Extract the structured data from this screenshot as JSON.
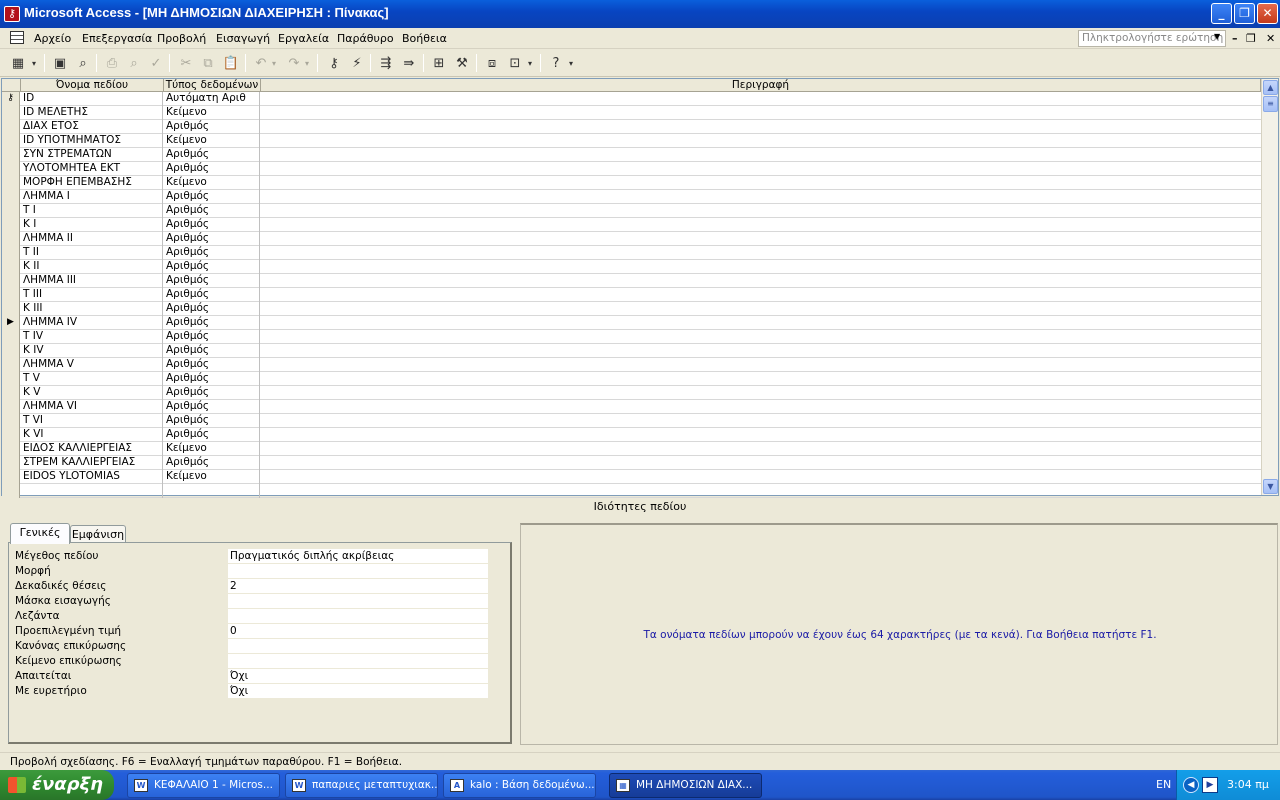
{
  "window": {
    "title": "Microsoft Access - [ΜΗ ΔΗΜΟΣΙΩΝ ΔΙΑΧΕΙΡΗΣΗ : Πίνακας]",
    "icon": "access-key-icon"
  },
  "menu": {
    "items": [
      "Αρχείο",
      "Επεξεργασία",
      "Προβολή",
      "Εισαγωγή",
      "Εργαλεία",
      "Παράθυρο",
      "Βοήθεια"
    ],
    "ask_placeholder": "Πληκτρολογήστε ερώτηση"
  },
  "grid": {
    "headers": {
      "field_name": "Όνομα πεδίου",
      "data_type": "Τύπος δεδομένων",
      "description": "Περιγραφή"
    },
    "rows": [
      {
        "name": "ID",
        "type": "Αυτόματη Αριθ",
        "marker": "key"
      },
      {
        "name": "ID ΜΕΛΕΤΗΣ",
        "type": "Κείμενο"
      },
      {
        "name": "ΔΙΑΧ ΕΤΟΣ",
        "type": "Αριθμός"
      },
      {
        "name": "ID ΥΠΟΤΜΗΜΑΤΟΣ",
        "type": "Κείμενο"
      },
      {
        "name": "ΣΥΝ ΣΤΡΕΜΑΤΩΝ",
        "type": "Αριθμός"
      },
      {
        "name": "ΥΛΟΤΟΜΗΤΕΑ ΕΚΤ",
        "type": "Αριθμός"
      },
      {
        "name": "ΜΟΡΦΗ ΕΠΕΜΒΑΣΗΣ",
        "type": "Κείμενο"
      },
      {
        "name": "ΛΗΜΜΑ Ι",
        "type": "Αριθμός"
      },
      {
        "name": "Τ Ι",
        "type": "Αριθμός"
      },
      {
        "name": "Κ Ι",
        "type": "Αριθμός"
      },
      {
        "name": "ΛΗΜΜΑ ΙΙ",
        "type": "Αριθμός"
      },
      {
        "name": "Τ ΙΙ",
        "type": "Αριθμός"
      },
      {
        "name": "Κ ΙΙ",
        "type": "Αριθμός"
      },
      {
        "name": "ΛΗΜΜΑ ΙΙΙ",
        "type": "Αριθμός"
      },
      {
        "name": "Τ ΙΙΙ",
        "type": "Αριθμός"
      },
      {
        "name": "Κ ΙΙΙ",
        "type": "Αριθμός"
      },
      {
        "name": "ΛΗΜΜΑ IV",
        "type": "Αριθμός",
        "marker": "current"
      },
      {
        "name": "Τ IV",
        "type": "Αριθμός"
      },
      {
        "name": "Κ IV",
        "type": "Αριθμός"
      },
      {
        "name": "ΛΗΜΜΑ V",
        "type": "Αριθμός"
      },
      {
        "name": "Τ V",
        "type": "Αριθμός"
      },
      {
        "name": "Κ V",
        "type": "Αριθμός"
      },
      {
        "name": "ΛΗΜΜΑ VI",
        "type": "Αριθμός"
      },
      {
        "name": "Τ VI",
        "type": "Αριθμός"
      },
      {
        "name": "Κ VI",
        "type": "Αριθμός"
      },
      {
        "name": "ΕΙΔΟΣ ΚΑΛΛΙΕΡΓΕΙΑΣ",
        "type": "Κείμενο"
      },
      {
        "name": "ΣΤΡΕΜ ΚΑΛΛΙΕΡΓΕΙΑΣ",
        "type": "Αριθμός"
      },
      {
        "name": "EIDOS YLOTOMIAS",
        "type": "Κείμενο"
      },
      {
        "name": "",
        "type": ""
      }
    ]
  },
  "properties": {
    "title": "Ιδιότητες πεδίου",
    "tabs": [
      "Γενικές",
      "Εμφάνιση"
    ],
    "rows": [
      {
        "label": "Μέγεθος πεδίου",
        "value": "Πραγματικός διπλής ακρίβειας"
      },
      {
        "label": "Μορφή",
        "value": ""
      },
      {
        "label": "Δεκαδικές θέσεις",
        "value": "2"
      },
      {
        "label": "Μάσκα εισαγωγής",
        "value": ""
      },
      {
        "label": "Λεζάντα",
        "value": ""
      },
      {
        "label": "Προεπιλεγμένη τιμή",
        "value": "0"
      },
      {
        "label": "Κανόνας επικύρωσης",
        "value": ""
      },
      {
        "label": "Κείμενο επικύρωσης",
        "value": ""
      },
      {
        "label": "Απαιτείται",
        "value": "Όχι"
      },
      {
        "label": "Με ευρετήριο",
        "value": "Όχι"
      }
    ],
    "help": "Τα ονόματα πεδίων μπορούν να έχουν έως 64 χαρακτήρες (με τα κενά). Για Βοήθεια πατήστε F1."
  },
  "status": "Προβολή σχεδίασης. F6 = Εναλλαγή τμημάτων παραθύρου.  F1 = Βοήθεια.",
  "taskbar": {
    "start": "έναρξη",
    "tasks": [
      {
        "label": "ΚΕΦΑΛΑΙΟ 1 - Micros...",
        "icon": "word-icon",
        "active": false
      },
      {
        "label": "παπαριες μεταπτυχιακ...",
        "icon": "word-icon",
        "active": false
      },
      {
        "label": "kalo : Βάση δεδομένω...",
        "icon": "access-icon",
        "active": false
      },
      {
        "label": "ΜΗ ΔΗΜΟΣΙΩΝ ΔΙΑΧ...",
        "icon": "table-icon",
        "active": true
      }
    ],
    "lang": "EN",
    "time": "3:04 πμ"
  }
}
